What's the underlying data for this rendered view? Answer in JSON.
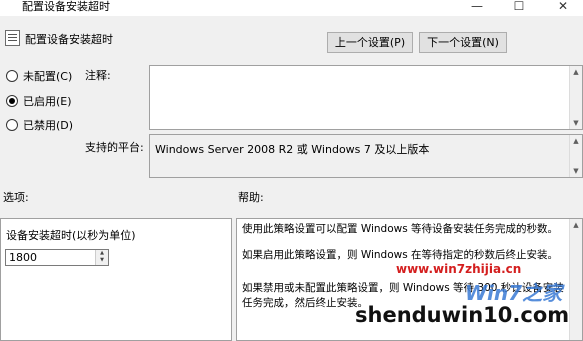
{
  "window": {
    "title": "配置设备安装超时",
    "minimize_glyph": "—",
    "maximize_glyph": "☐",
    "close_glyph": "✕"
  },
  "header": {
    "title": "配置设备安装超时",
    "prev_button": "上一个设置(P)",
    "next_button": "下一个设置(N)"
  },
  "state_options": [
    {
      "label": "未配置(C)",
      "selected": false
    },
    {
      "label": "已启用(E)",
      "selected": true
    },
    {
      "label": "已禁用(D)",
      "selected": false
    }
  ],
  "comment": {
    "label": "注释:",
    "value": ""
  },
  "platform": {
    "label": "支持的平台:",
    "value": "Windows Server 2008 R2 或 Windows 7 及以上版本"
  },
  "options": {
    "section_label": "选项:",
    "field_label": "设备安装超时(以秒为单位)",
    "field_value": "1800"
  },
  "help": {
    "section_label": "帮助:",
    "paragraphs": [
      "使用此策略设置可以配置 Windows 等待设备安装任务完成的秒数。",
      "如果启用此策略设置，则 Windows 在等待指定的秒数后终止安装。",
      "如果禁用或未配置此策略设置，则 Windows 等待 300 秒让设备安装任务完成，然后终止安装。"
    ]
  },
  "watermarks": {
    "url": "www.win7zhijia.cn",
    "logo": "Win7之家",
    "site": "shenduwin10.com"
  }
}
